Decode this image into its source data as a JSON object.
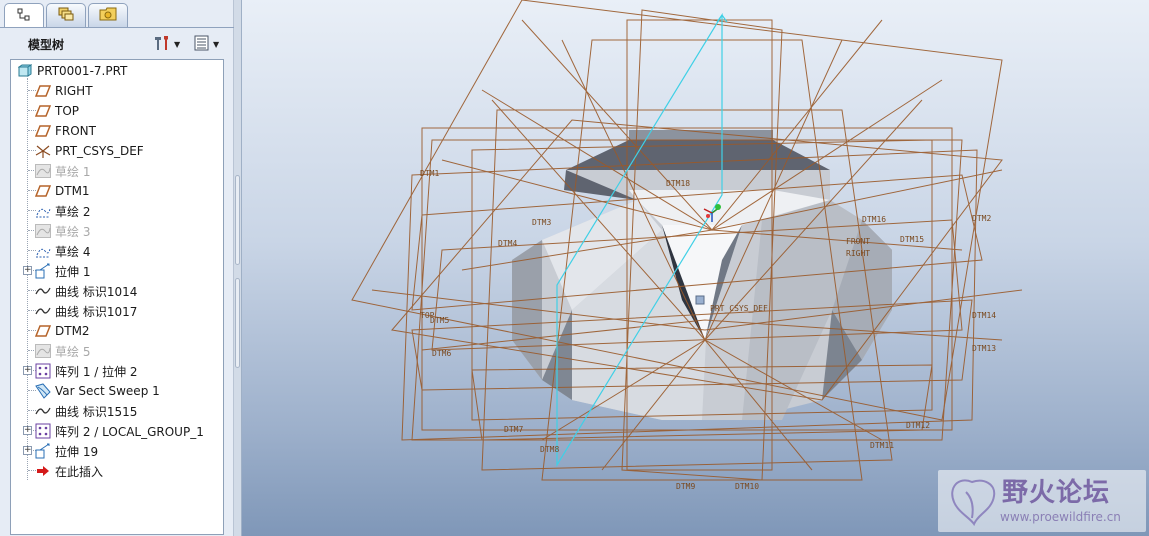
{
  "panel_tabs": [
    {
      "icon": "model-tree-icon",
      "active": true
    },
    {
      "icon": "layers-icon",
      "active": false
    },
    {
      "icon": "favorites-folder-icon",
      "active": false
    }
  ],
  "tree": {
    "title": "模型树",
    "settings_icon": "tree-settings-icon",
    "columns_icon": "tree-columns-icon",
    "items": [
      {
        "label": "PRT0001-7.PRT",
        "icon": "part-icon",
        "state": "normal",
        "expandable": false
      },
      {
        "label": "RIGHT",
        "icon": "datum-plane-icon",
        "state": "normal",
        "expandable": false
      },
      {
        "label": "TOP",
        "icon": "datum-plane-icon",
        "state": "normal",
        "expandable": false
      },
      {
        "label": "FRONT",
        "icon": "datum-plane-icon",
        "state": "normal",
        "expandable": false
      },
      {
        "label": "PRT_CSYS_DEF",
        "icon": "csys-icon",
        "state": "normal",
        "expandable": false
      },
      {
        "label": "草绘 1",
        "icon": "sketch-icon",
        "state": "suppressed",
        "expandable": false
      },
      {
        "label": "DTM1",
        "icon": "datum-plane-icon",
        "state": "normal",
        "expandable": false
      },
      {
        "label": "草绘 2",
        "icon": "sketch-icon",
        "state": "normal",
        "expandable": false
      },
      {
        "label": "草绘 3",
        "icon": "sketch-icon",
        "state": "suppressed",
        "expandable": false
      },
      {
        "label": "草绘 4",
        "icon": "sketch-icon",
        "state": "normal",
        "expandable": false
      },
      {
        "label": "拉伸 1",
        "icon": "extrude-icon",
        "state": "normal",
        "expandable": true
      },
      {
        "label": "曲线 标识1014",
        "icon": "curve-icon",
        "state": "normal",
        "expandable": false
      },
      {
        "label": "曲线 标识1017",
        "icon": "curve-icon",
        "state": "normal",
        "expandable": false
      },
      {
        "label": "DTM2",
        "icon": "datum-plane-icon",
        "state": "normal",
        "expandable": false
      },
      {
        "label": "草绘 5",
        "icon": "sketch-icon",
        "state": "suppressed",
        "expandable": false
      },
      {
        "label": "阵列 1 / 拉伸 2",
        "icon": "pattern-icon",
        "state": "normal",
        "expandable": true
      },
      {
        "label": "Var Sect Sweep 1",
        "icon": "sweep-icon",
        "state": "normal",
        "expandable": false
      },
      {
        "label": "曲线 标识1515",
        "icon": "curve-icon",
        "state": "normal",
        "expandable": false
      },
      {
        "label": "阵列 2 / LOCAL_GROUP_1",
        "icon": "pattern-icon",
        "state": "normal",
        "expandable": true
      },
      {
        "label": "拉伸 19",
        "icon": "extrude-icon",
        "state": "normal",
        "expandable": true
      },
      {
        "label": "在此插入",
        "icon": "insert-here-arrow-icon",
        "state": "normal",
        "expandable": false
      }
    ]
  },
  "viewport": {
    "datum_labels": [
      "DTM1",
      "DTM2",
      "DTM3",
      "DTM4",
      "DTM5",
      "DTM6",
      "DTM7",
      "DTM8",
      "DTM9",
      "DTM10",
      "DTM11",
      "DTM12",
      "DTM13",
      "DTM14",
      "DTM15",
      "DTM16",
      "DTM18",
      "FRONT",
      "RIGHT",
      "TOP",
      "PRT_CSYS_DEF"
    ],
    "csys_label": "PRT_CSYS_DEF"
  },
  "watermark": {
    "brand": "野火论坛",
    "url": "www.proewildfire.cn"
  },
  "colors": {
    "datum_line": "#9a5a2a",
    "highlight_line": "#3fd0e6",
    "surface_light": "#e6eaf0",
    "surface_dark": "#5f6470",
    "tree_selection": "#d9e6f7"
  }
}
